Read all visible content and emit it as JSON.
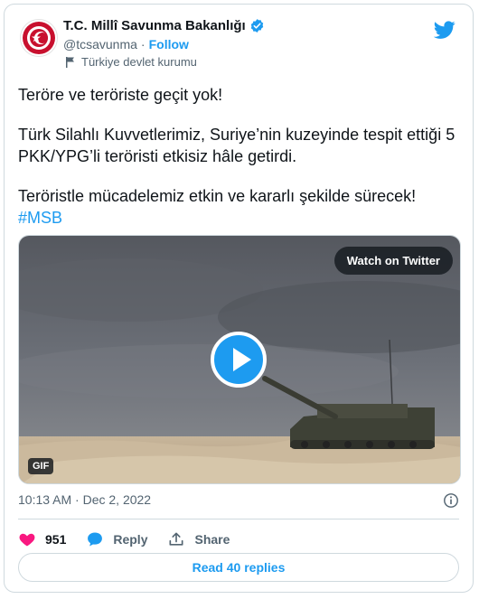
{
  "account": {
    "name": "T.C. Millî Savunma Bakanlığı",
    "handle": "@tcsavunma",
    "separator": "·",
    "follow_label": "Follow",
    "label": "Türkiye devlet kurumu"
  },
  "tweet": {
    "line1": "Teröre ve teröriste geçit yok!",
    "line2": "Türk Silahlı Kuvvetlerimiz, Suriye’nin kuzeyinde tespit ettiği 5 PKK/YPG’li teröristi etkisiz hâle getirdi.",
    "line3": "Teröristle mücadelemiz etkin ve kararlı şekilde sürecek!",
    "hashtag": "#MSB"
  },
  "media": {
    "watch_label": "Watch on Twitter",
    "gif_badge": "GIF"
  },
  "meta": {
    "timestamp": "10:13 AM · Dec 2, 2022"
  },
  "actions": {
    "like_count": "951",
    "reply_label": "Reply",
    "share_label": "Share"
  },
  "read_replies_label": "Read 40 replies",
  "colors": {
    "accent": "#1d9bf0",
    "like": "#f91880",
    "text": "#0f1419",
    "muted": "#536471",
    "emblem_red": "#c8102e"
  }
}
